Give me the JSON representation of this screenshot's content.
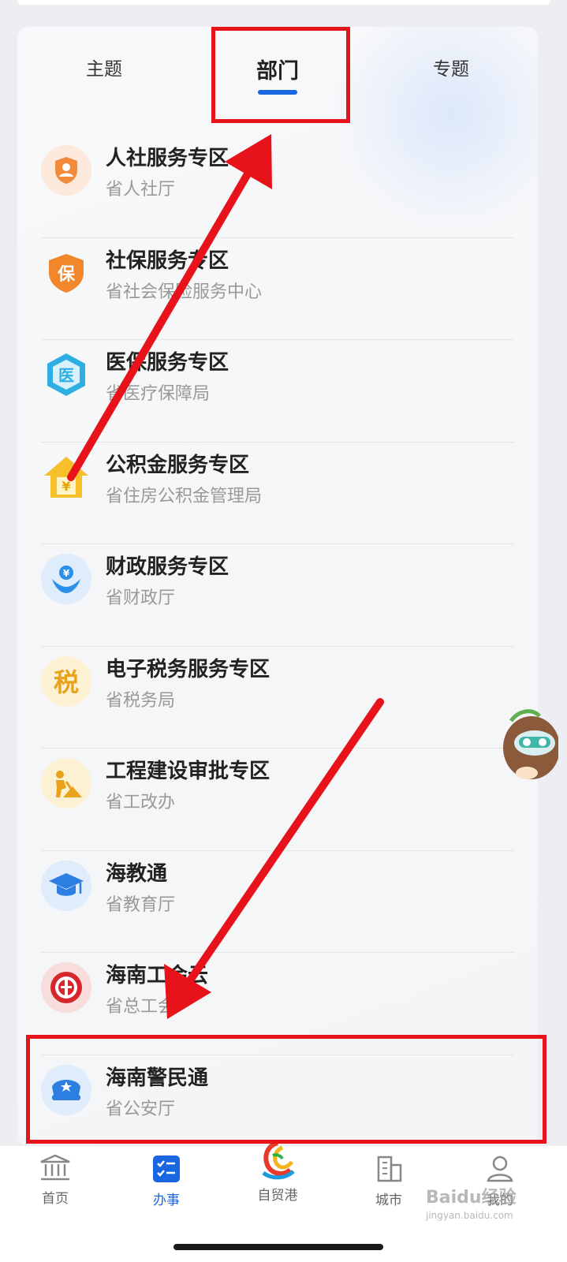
{
  "tabs": [
    {
      "label": "主题"
    },
    {
      "label": "部门"
    },
    {
      "label": "专题"
    }
  ],
  "list": [
    {
      "title": "人社服务专区",
      "subtitle": "省人社厅",
      "icon": "person-shield-icon",
      "color": "#f28a3c"
    },
    {
      "title": "社保服务专区",
      "subtitle": "省社会保险服务中心",
      "icon": "bao-shield-icon",
      "color": "#f2862a"
    },
    {
      "title": "医保服务专区",
      "subtitle": "省医疗保障局",
      "icon": "yi-hexagon-icon",
      "color": "#2eaee3"
    },
    {
      "title": "公积金服务专区",
      "subtitle": "省住房公积金管理局",
      "icon": "house-yuan-icon",
      "color": "#f5c02a"
    },
    {
      "title": "财政服务专区",
      "subtitle": "省财政厅",
      "icon": "hands-yuan-icon",
      "color": "#2c8fe8"
    },
    {
      "title": "电子税务服务专区",
      "subtitle": "省税务局",
      "icon": "tax-icon",
      "color": "#e8a21c"
    },
    {
      "title": "工程建设审批专区",
      "subtitle": "省工改办",
      "icon": "worker-icon",
      "color": "#e8a21c"
    },
    {
      "title": "海教通",
      "subtitle": "省教育厅",
      "icon": "graduation-cap-icon",
      "color": "#2c7fe0"
    },
    {
      "title": "海南工会云",
      "subtitle": "省总工会",
      "icon": "union-logo-icon",
      "color": "#d7262c"
    },
    {
      "title": "海南警民通",
      "subtitle": "省公安厅",
      "icon": "police-cap-icon",
      "color": "#2c7fe0"
    }
  ],
  "nav": [
    {
      "label": "首页",
      "icon": "building-icon",
      "active": false
    },
    {
      "label": "办事",
      "icon": "checklist-icon",
      "active": true
    },
    {
      "label": "自贸港",
      "icon": "fta-logo-icon",
      "active": false
    },
    {
      "label": "城市",
      "icon": "city-icon",
      "active": false
    },
    {
      "label": "我的",
      "icon": "user-icon",
      "active": false
    }
  ],
  "colors": {
    "accent": "#1a66e0",
    "annotation": "#e8121b"
  },
  "watermark": {
    "brand": "Baidu经验",
    "url": "jingyan.baidu.com"
  }
}
